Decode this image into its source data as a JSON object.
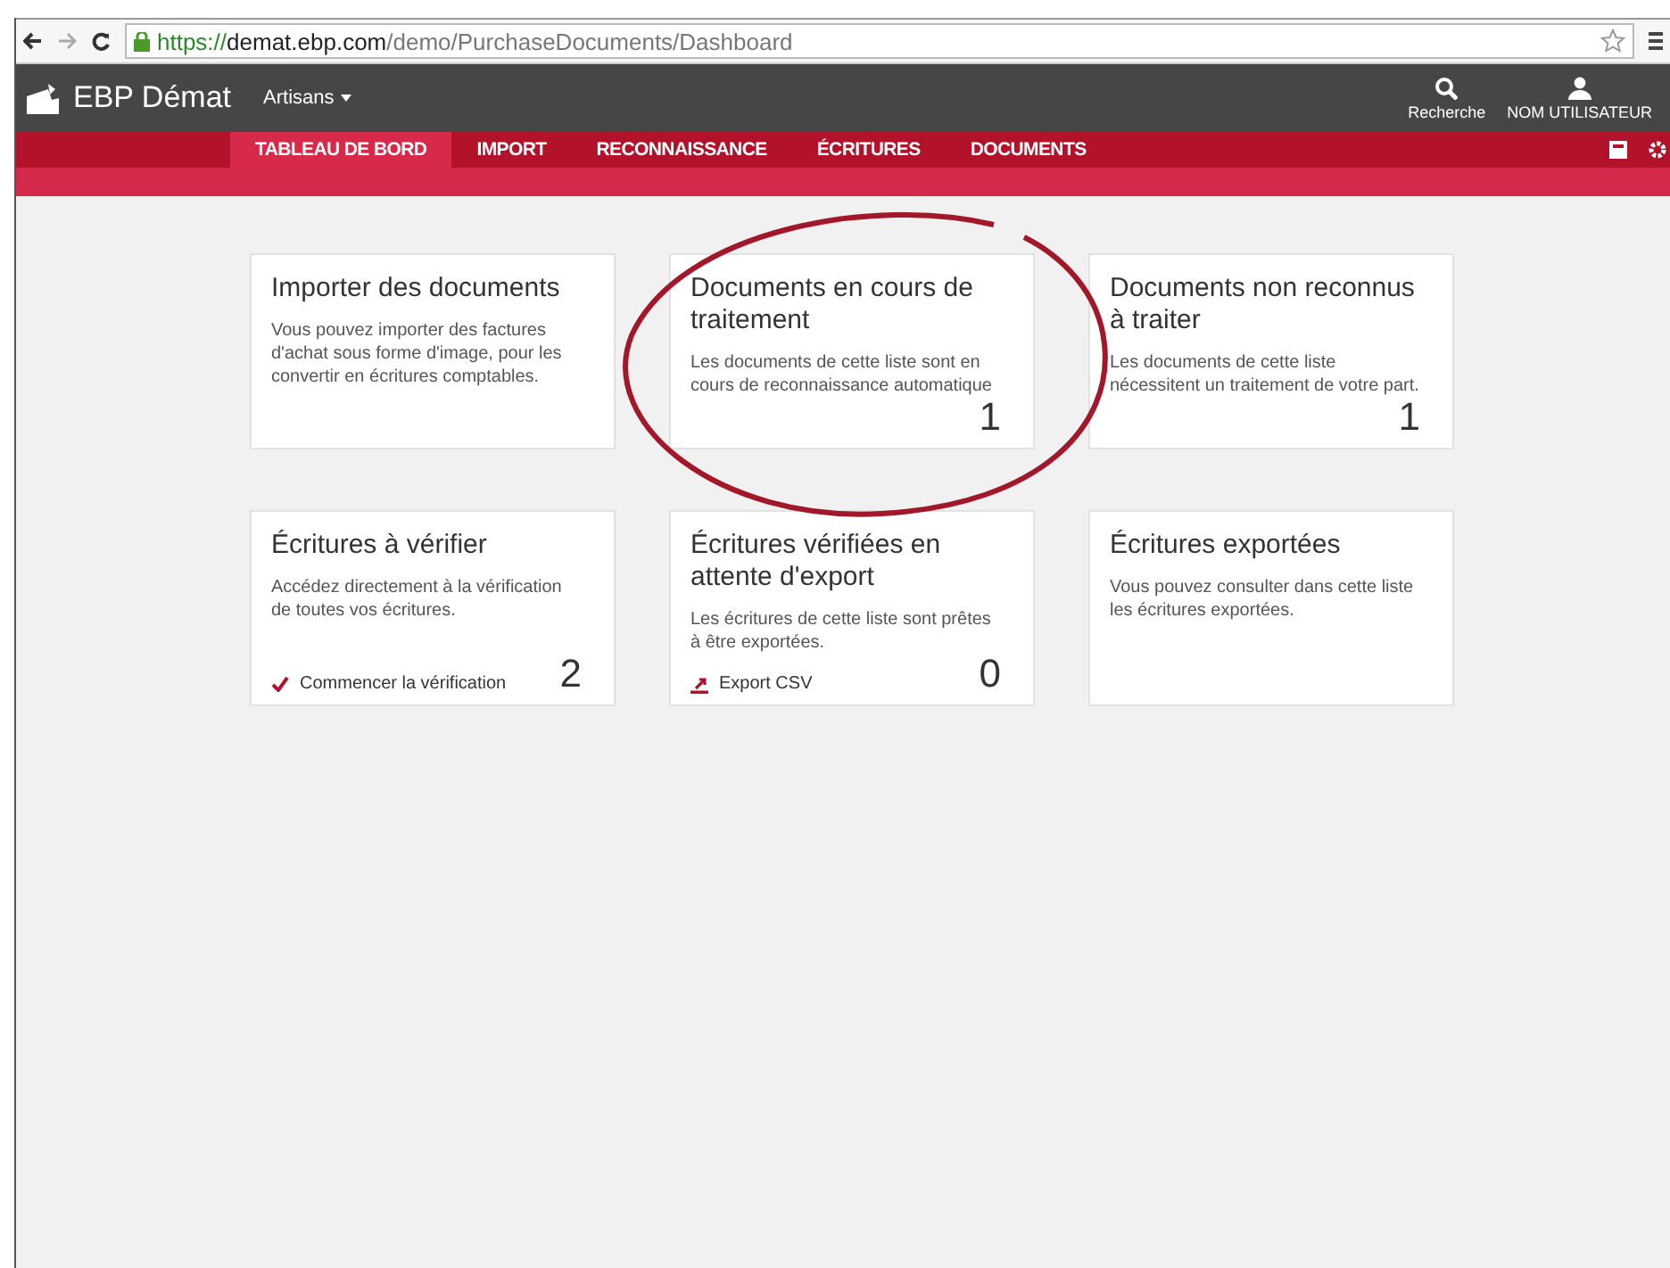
{
  "browser": {
    "url_scheme": "https://",
    "url_host": "demat.ebp.com",
    "url_path": "/demo/PurchaseDocuments/Dashboard"
  },
  "header": {
    "brand": "EBP Démat",
    "company": "Artisans",
    "search_label": "Recherche",
    "user_label": "NOM UTILISATEUR"
  },
  "tabs": [
    {
      "label": "TABLEAU DE BORD",
      "selected": true
    },
    {
      "label": "IMPORT",
      "selected": false
    },
    {
      "label": "RECONNAISSANCE",
      "selected": false
    },
    {
      "label": "ÉCRITURES",
      "selected": false
    },
    {
      "label": "DOCUMENTS",
      "selected": false
    }
  ],
  "cards": [
    {
      "title": "Importer des documents",
      "description": "Vous pouvez importer des factures d'achat sous forme d'image, pour les convertir en écritures comptables."
    },
    {
      "title": "Documents en cours de traitement",
      "description": "Les documents de cette liste sont en cours de reconnaissance automatique",
      "count": "1",
      "highlighted": true
    },
    {
      "title": "Documents non reconnus à traiter",
      "description": "Les documents de cette liste nécessitent un traitement de votre part.",
      "count": "1"
    },
    {
      "title": "Écritures à vérifier",
      "description": "Accédez directement à la vérification de toutes vos écritures.",
      "count": "2",
      "action": {
        "kind": "check",
        "label": "Commencer la vérification"
      }
    },
    {
      "title": "Écritures vérifiées en attente d'export",
      "description": "Les écritures de cette liste sont prêtes à être exportées.",
      "count": "0",
      "action": {
        "kind": "export",
        "label": "Export CSV"
      }
    },
    {
      "title": "Écritures exportées",
      "description": "Vous pouvez consulter dans cette liste les écritures exportées."
    }
  ]
}
